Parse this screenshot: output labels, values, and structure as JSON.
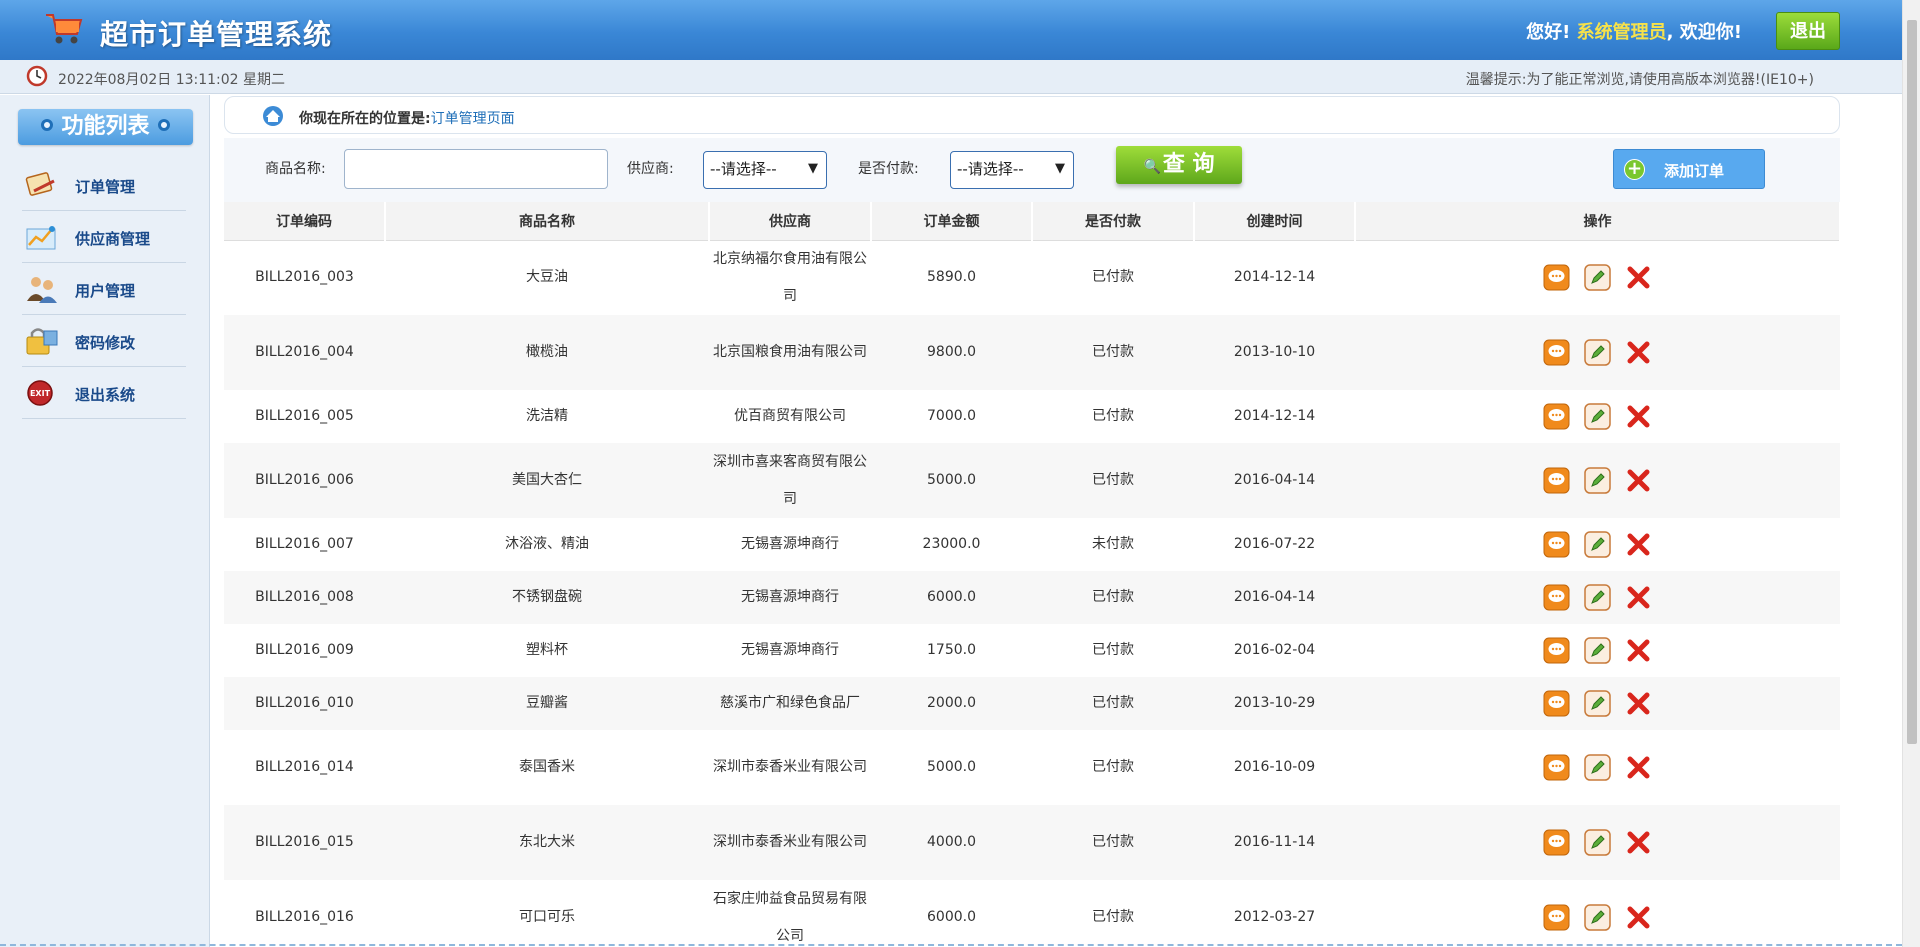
{
  "app": {
    "title": "超市订单管理系统",
    "greeting_prefix": "您好!",
    "user": "系统管理员",
    "greeting_suffix": ", 欢迎你!",
    "logout_label": "退出"
  },
  "infobar": {
    "datetime": "2022年08月02日 13:11:02 星期二",
    "tip": "温馨提示:为了能正常浏览,请使用高版本浏览器!(IE10+)"
  },
  "sidebar": {
    "title": "功能列表",
    "items": [
      {
        "label": "订单管理",
        "icon": "order-icon"
      },
      {
        "label": "供应商管理",
        "icon": "supplier-icon"
      },
      {
        "label": "用户管理",
        "icon": "users-icon"
      },
      {
        "label": "密码修改",
        "icon": "password-icon"
      },
      {
        "label": "退出系统",
        "icon": "exit-icon"
      }
    ]
  },
  "breadcrumb": {
    "prefix": "你现在所在的位置是:",
    "current": "订单管理页面"
  },
  "search": {
    "product_label": "商品名称:",
    "product_value": "",
    "provider_label": "供应商:",
    "provider_selected": "--请选择--",
    "paid_label": "是否付款:",
    "paid_selected": "--请选择--",
    "query_label": "查 询",
    "add_label": "添加订单"
  },
  "table": {
    "headers": [
      "订单编码",
      "商品名称",
      "供应商",
      "订单金额",
      "是否付款",
      "创建时间",
      "操作"
    ],
    "rows": [
      {
        "code": "BILL2016_003",
        "product": "大豆油",
        "provider": "北京纳福尔食用油有限公司",
        "amount": "5890.0",
        "paid": "已付款",
        "date": "2014-12-14"
      },
      {
        "code": "BILL2016_004",
        "product": "橄榄油",
        "provider": "北京国粮食用油有限公司",
        "amount": "9800.0",
        "paid": "已付款",
        "date": "2013-10-10"
      },
      {
        "code": "BILL2016_005",
        "product": "洗洁精",
        "provider": "优百商贸有限公司",
        "amount": "7000.0",
        "paid": "已付款",
        "date": "2014-12-14"
      },
      {
        "code": "BILL2016_006",
        "product": "美国大杏仁",
        "provider": "深圳市喜来客商贸有限公司",
        "amount": "5000.0",
        "paid": "已付款",
        "date": "2016-04-14"
      },
      {
        "code": "BILL2016_007",
        "product": "沐浴液、精油",
        "provider": "无锡喜源坤商行",
        "amount": "23000.0",
        "paid": "未付款",
        "date": "2016-07-22"
      },
      {
        "code": "BILL2016_008",
        "product": "不锈钢盘碗",
        "provider": "无锡喜源坤商行",
        "amount": "6000.0",
        "paid": "已付款",
        "date": "2016-04-14"
      },
      {
        "code": "BILL2016_009",
        "product": "塑料杯",
        "provider": "无锡喜源坤商行",
        "amount": "1750.0",
        "paid": "已付款",
        "date": "2016-02-04"
      },
      {
        "code": "BILL2016_010",
        "product": "豆瓣酱",
        "provider": "慈溪市广和绿色食品厂",
        "amount": "2000.0",
        "paid": "已付款",
        "date": "2013-10-29"
      },
      {
        "code": "BILL2016_014",
        "product": "泰国香米",
        "provider": "深圳市泰香米业有限公司",
        "amount": "5000.0",
        "paid": "已付款",
        "date": "2016-10-09"
      },
      {
        "code": "BILL2016_015",
        "product": "东北大米",
        "provider": "深圳市泰香米业有限公司",
        "amount": "4000.0",
        "paid": "已付款",
        "date": "2016-11-14"
      },
      {
        "code": "BILL2016_016",
        "product": "可口可乐",
        "provider": "石家庄帅益食品贸易有限公司",
        "amount": "6000.0",
        "paid": "已付款",
        "date": "2012-03-27"
      }
    ]
  },
  "colors": {
    "header_blue": "#3a87d6",
    "accent_green": "#5ea71b",
    "user_yellow": "#f7e24a",
    "link_blue": "#1f6fb8"
  }
}
